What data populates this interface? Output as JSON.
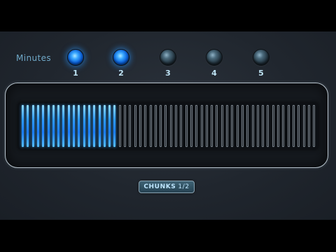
{
  "minutes": {
    "label": "Minutes",
    "indicators": [
      {
        "number": "1",
        "active": true
      },
      {
        "number": "2",
        "active": true
      },
      {
        "number": "3",
        "active": false
      },
      {
        "number": "4",
        "active": false
      },
      {
        "number": "5",
        "active": false
      }
    ]
  },
  "meter": {
    "total_bars": 58,
    "lit_bars": 19,
    "lit_color": "#2e9bff",
    "dim_color": "#7d8790"
  },
  "chunks_button": {
    "label": "CHUNKS",
    "value": "1/2"
  }
}
